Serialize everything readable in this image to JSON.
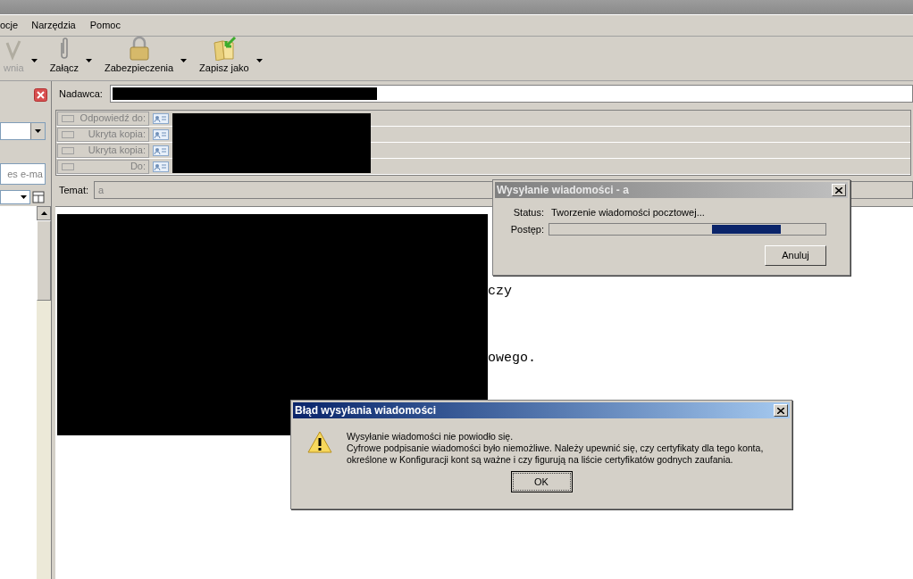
{
  "menu": [
    "ocje",
    "Narzędzia",
    "Pomoc"
  ],
  "toolbar": [
    {
      "label": "wnia",
      "kind": "pen",
      "disabled": true
    },
    {
      "label": "Załącz",
      "kind": "clip",
      "disabled": false
    },
    {
      "label": "Zabezpieczenia",
      "kind": "lock",
      "disabled": false
    },
    {
      "label": "Zapisz jako",
      "kind": "folder",
      "disabled": false
    }
  ],
  "sidebar": {
    "field_value": "es e-ma"
  },
  "header": {
    "sender_label": "Nadawca:",
    "recipients": [
      {
        "label": "Odpowiedź do:"
      },
      {
        "label": "Ukryta kopia:"
      },
      {
        "label": "Ukryta kopia:"
      },
      {
        "label": "Do:"
      }
    ],
    "subject_label": "Temat:",
    "subject_value": "a"
  },
  "body": {
    "lines": [
      {
        "text": "czy"
      },
      {
        "text": "owego."
      }
    ]
  },
  "progress_dialog": {
    "title": "Wysyłanie wiadomości - a",
    "status_label": "Status:",
    "status_value": "Tworzenie wiadomości pocztowej...",
    "progress_label": "Postęp:",
    "button": "Anuluj"
  },
  "error_dialog": {
    "title": "Błąd wysyłania wiadomości",
    "lines": [
      "Wysyłanie wiadomości nie powiodło się.",
      "Cyfrowe podpisanie wiadomości było niemożliwe. Należy upewnić się, czy certyfikaty dla tego konta,",
      "określone w Konfiguracji kont są ważne i czy figurują na liście certyfikatów godnych zaufania."
    ],
    "button": "OK"
  }
}
